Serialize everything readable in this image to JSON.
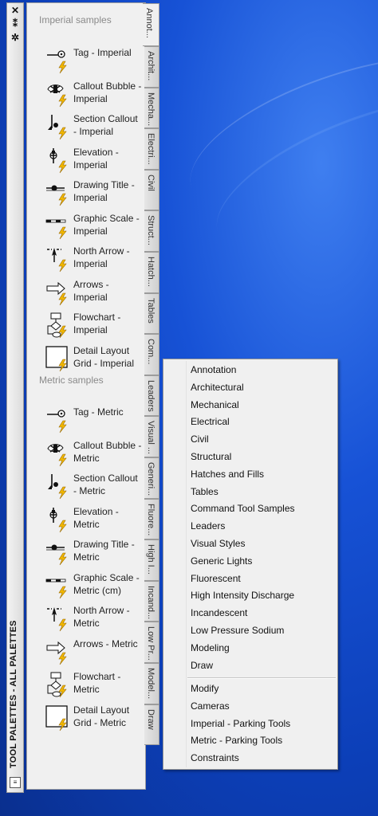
{
  "palette": {
    "title": "TOOL PALETTES - ALL PALETTES",
    "close_glyph": "✕",
    "pin_glyph": "⁑",
    "settings_glyph": "✲",
    "sections": [
      {
        "header": "Imperial samples",
        "tools": [
          {
            "label": "Tag - Imperial",
            "icon": "tag-icon"
          },
          {
            "label": "Callout Bubble - Imperial",
            "icon": "callout-bubble-icon"
          },
          {
            "label": "Section Callout - Imperial",
            "icon": "section-callout-icon"
          },
          {
            "label": "Elevation - Imperial",
            "icon": "elevation-icon"
          },
          {
            "label": "Drawing Title - Imperial",
            "icon": "drawing-title-icon"
          },
          {
            "label": "Graphic Scale - Imperial",
            "icon": "graphic-scale-icon"
          },
          {
            "label": "North Arrow - Imperial",
            "icon": "north-arrow-icon"
          },
          {
            "label": "Arrows - Imperial",
            "icon": "arrow-icon"
          },
          {
            "label": "Flowchart - Imperial",
            "icon": "flowchart-icon"
          },
          {
            "label": "Detail Layout Grid - Imperial",
            "icon": "detail-layout-grid-icon"
          }
        ]
      },
      {
        "header": "Metric samples",
        "tools": [
          {
            "label": "Tag - Metric",
            "icon": "tag-icon"
          },
          {
            "label": "Callout Bubble - Metric",
            "icon": "callout-bubble-icon"
          },
          {
            "label": "Section Callout - Metric",
            "icon": "section-callout-icon"
          },
          {
            "label": "Elevation - Metric",
            "icon": "elevation-icon"
          },
          {
            "label": "Drawing Title - Metric",
            "icon": "drawing-title-icon"
          },
          {
            "label": "Graphic Scale - Metric (cm)",
            "icon": "graphic-scale-icon"
          },
          {
            "label": "North Arrow - Metric",
            "icon": "north-arrow-icon"
          },
          {
            "label": "Arrows - Metric",
            "icon": "arrow-icon"
          },
          {
            "label": "Flowchart - Metric",
            "icon": "flowchart-icon"
          },
          {
            "label": "Detail Layout Grid - Metric",
            "icon": "detail-layout-grid-icon"
          }
        ]
      }
    ],
    "tabs": [
      {
        "label": "Annot...",
        "active": true
      },
      {
        "label": "Archit..."
      },
      {
        "label": "Mecha..."
      },
      {
        "label": "Electri..."
      },
      {
        "label": "Civil"
      },
      {
        "label": "Struct..."
      },
      {
        "label": "Hatch..."
      },
      {
        "label": "Tables"
      },
      {
        "label": "Com..."
      },
      {
        "label": "Leaders"
      },
      {
        "label": "Visual ..."
      },
      {
        "label": "Generi..."
      },
      {
        "label": "Fluore..."
      },
      {
        "label": "High I..."
      },
      {
        "label": "Incand..."
      },
      {
        "label": "Low Pr..."
      },
      {
        "label": "Model..."
      },
      {
        "label": "Draw"
      }
    ]
  },
  "menu": {
    "group1": [
      "Annotation",
      "Architectural",
      "Mechanical",
      "Electrical",
      "Civil",
      "Structural",
      "Hatches and Fills",
      "Tables",
      "Command Tool Samples",
      "Leaders",
      "Visual Styles",
      "Generic Lights",
      "Fluorescent",
      "High Intensity Discharge",
      "Incandescent",
      "Low Pressure Sodium",
      "Modeling",
      "Draw"
    ],
    "group2": [
      "Modify",
      "Cameras",
      "Imperial - Parking Tools",
      "Metric - Parking Tools",
      "Constraints"
    ]
  },
  "colors": {
    "desktop": "#1450cc",
    "lightning": "#f2b800"
  }
}
